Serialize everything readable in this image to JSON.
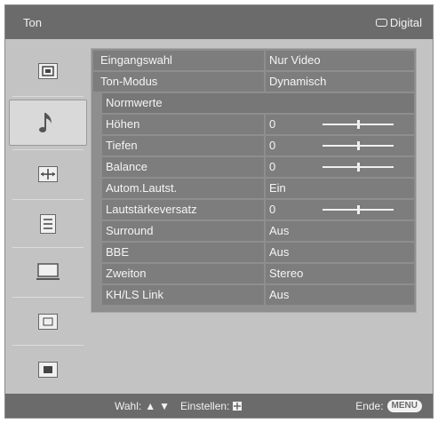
{
  "header": {
    "title": "Ton",
    "digital_label": "Digital"
  },
  "sidebar": {
    "items": [
      {
        "icon": "picture-icon"
      },
      {
        "icon": "music-note-icon"
      },
      {
        "icon": "screen-icon"
      },
      {
        "icon": "setup-icon"
      },
      {
        "icon": "pc-icon"
      },
      {
        "icon": "analog-input-icon"
      },
      {
        "icon": "digital-input-icon"
      }
    ]
  },
  "settings": {
    "eingangswahl": {
      "label": "Eingangswahl",
      "value": "Nur Video"
    },
    "ton_modus": {
      "label": "Ton-Modus",
      "value": "Dynamisch"
    },
    "normwerte": {
      "label": "Normwerte"
    },
    "hoehen": {
      "label": "Höhen",
      "value": "0",
      "level": 0.5
    },
    "tiefen": {
      "label": "Tiefen",
      "value": "0",
      "level": 0.5
    },
    "balance": {
      "label": "Balance",
      "value": "0",
      "level": 0.5
    },
    "autom_lautst": {
      "label": "Autom.Lautst.",
      "value": "Ein"
    },
    "lautstaerkeversatz": {
      "label": "Lautstärkeversatz",
      "value": "0",
      "level": 0.5
    },
    "surround": {
      "label": "Surround",
      "value": "Aus"
    },
    "bbe": {
      "label": "BBE",
      "value": "Aus"
    },
    "zweiton": {
      "label": "Zweiton",
      "value": "Stereo"
    },
    "kh_ls_link": {
      "label": "KH/LS Link",
      "value": "Aus"
    }
  },
  "footer": {
    "wahl_label": "Wahl:",
    "einstellen_label": "Einstellen:",
    "ende_label": "Ende:",
    "menu_key": "MENU"
  }
}
